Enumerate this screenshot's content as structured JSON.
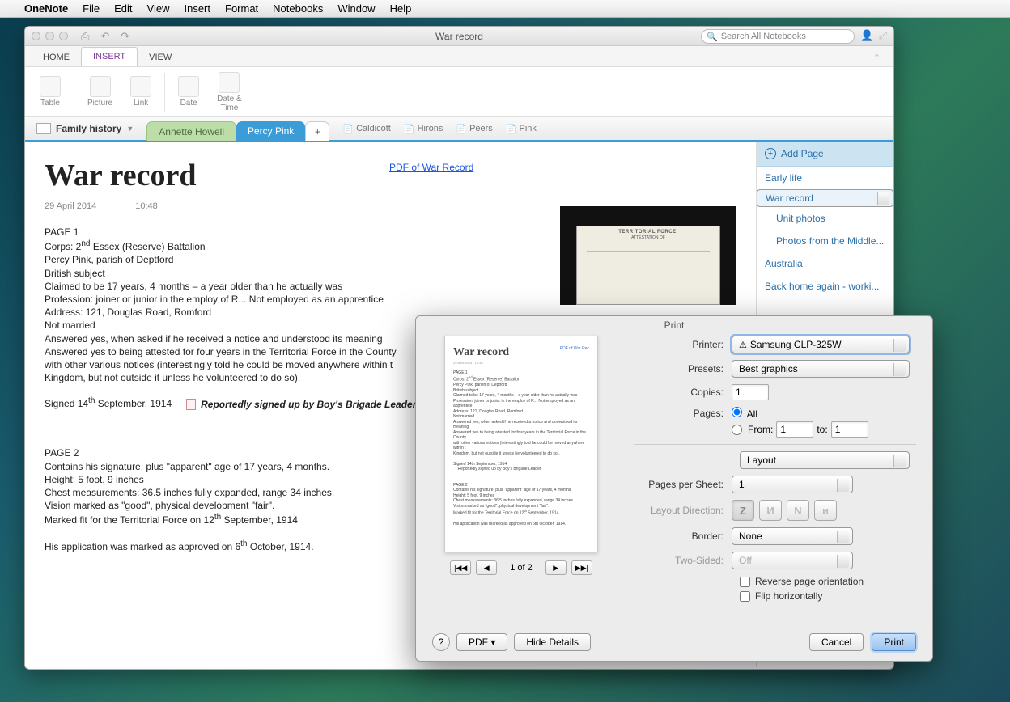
{
  "mac_menu": {
    "apple": "",
    "app": "OneNote",
    "items": [
      "File",
      "Edit",
      "View",
      "Insert",
      "Format",
      "Notebooks",
      "Window",
      "Help"
    ]
  },
  "window": {
    "title": "War record",
    "search_placeholder": "Search All Notebooks",
    "ribbon_tabs": {
      "home": "HOME",
      "insert": "INSERT",
      "view": "VIEW"
    },
    "ribbon_items": {
      "table": "Table",
      "picture": "Picture",
      "link": "Link",
      "date": "Date",
      "datetime": "Date &\nTime"
    },
    "notebook": "Family history",
    "section_tabs": {
      "green": "Annette Howell",
      "blue": "Percy Pink",
      "add": "+"
    },
    "right_tags": [
      "Caldicott",
      "Hirons",
      "Peers",
      "Pink"
    ]
  },
  "page": {
    "title": "War record",
    "date": "29 April 2014",
    "time": "10:48",
    "link": "PDF of War Record",
    "lines1": [
      "PAGE 1",
      "Corps: 2<sup>nd</sup> Essex (Reserve) Battalion",
      "Percy Pink, parish of Deptford",
      "British subject",
      "Claimed to be 17 years, 4 months – a year older than he actually was",
      "Profession: joiner or junior in the employ of R... Not employed as an apprentice",
      "Address: 121, Douglas Road, Romford",
      "Not married",
      "Answered yes, when asked if he received a notice and understood its meaning",
      "Answered yes to being attested for four years in the Territorial Force in the County",
      "with other various notices (interestingly told he could be moved anywhere within t",
      "Kingdom, but not outside it unless he volunteered to do so)."
    ],
    "signed1": "Signed 14<sup>th</sup> September, 1914",
    "tagnote": "Reportedly signed up by Boy's Brigade Leader",
    "lines2": [
      "PAGE 2",
      "Contains his signature, plus \"apparent\" age of 17 years, 4 months.",
      "Height: 5 foot, 9 inches",
      "Chest measurements: 36.5 inches fully expanded, range 34 inches.",
      "Vision marked as \"good\", physical development \"fair\".",
      "Marked fit for the Territorial Force on 12<sup>th</sup> September, 1914"
    ],
    "final": "His application was marked as approved on 6<sup>th</sup> October, 1914."
  },
  "side": {
    "add": "Add Page",
    "items": [
      {
        "label": "Early life",
        "sub": false,
        "sel": false
      },
      {
        "label": "War record",
        "sub": false,
        "sel": true
      },
      {
        "label": "Unit photos",
        "sub": true,
        "sel": false
      },
      {
        "label": "Photos from the Middle...",
        "sub": true,
        "sel": false
      },
      {
        "label": "Australia",
        "sub": false,
        "sel": false
      },
      {
        "label": "Back home again - worki...",
        "sub": false,
        "sel": false
      }
    ]
  },
  "print": {
    "title": "Print",
    "printer_lbl": "Printer:",
    "printer_val": "Samsung CLP-325W",
    "presets_lbl": "Presets:",
    "presets_val": "Best graphics",
    "copies_lbl": "Copies:",
    "copies_val": "1",
    "pages_lbl": "Pages:",
    "pages_all": "All",
    "pages_from": "From:",
    "from_val": "1",
    "pages_to": "to:",
    "to_val": "1",
    "layout": "Layout",
    "pps_lbl": "Pages per Sheet:",
    "pps_val": "1",
    "dir_lbl": "Layout Direction:",
    "border_lbl": "Border:",
    "border_val": "None",
    "ts_lbl": "Two-Sided:",
    "ts_val": "Off",
    "rev": "Reverse page orientation",
    "flip": "Flip horizontally",
    "nav": "1 of 2",
    "help": "?",
    "pdf": "PDF ▾",
    "hide": "Hide Details",
    "cancel": "Cancel",
    "print_btn": "Print",
    "preview_title": "War record",
    "preview_link": "PDF of War Rec"
  }
}
